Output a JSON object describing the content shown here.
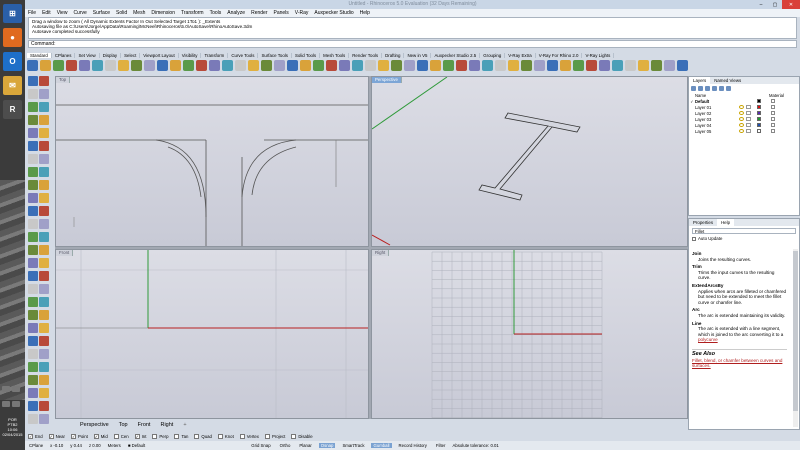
{
  "window": {
    "title": "Untitled - Rhinoceros 5.0 Evaluation (32 Days Remaining)"
  },
  "menu": [
    "File",
    "Edit",
    "View",
    "Curve",
    "Surface",
    "Solid",
    "Mesh",
    "Dimension",
    "Transform",
    "Tools",
    "Analyze",
    "Render",
    "Panels",
    "V-Ray",
    "Auxpecker Studio",
    "Help"
  ],
  "history": [
    "Drag a window to zoom ( All  Dynamic  Extents  Factor  In  Out  Selected  Target  1To1 ): _Extents",
    "Autosaving file as C:\\Users\\Jorge\\AppData\\Roaming\\McNeel\\Rhinoceros\\5.0\\AutoSave\\RhinoAutoSave.3dm",
    "Autosave completed successfully"
  ],
  "command": {
    "label": "Command:",
    "value": ""
  },
  "toolbar_tabs": [
    "Standard",
    "CPlanes",
    "Set View",
    "Display",
    "Select",
    "Viewport Layout",
    "Visibility",
    "Transform",
    "Curve Tools",
    "Surface Tools",
    "Solid Tools",
    "Mesh Tools",
    "Render Tools",
    "Drafting",
    "New in V5",
    "Auxpecker Studio 2.5",
    "Grouping",
    "V-Ray Extra",
    "V-Ray For Rhino 2.0",
    "V-Ray Lights"
  ],
  "viewports": {
    "top": "Top",
    "perspective": "Perspective",
    "front": "Front",
    "right": "Right"
  },
  "view_tabs": [
    "Perspective",
    "Top",
    "Front",
    "Right"
  ],
  "view_tabs_add": "+",
  "osnaps": [
    {
      "label": "End",
      "checked": true
    },
    {
      "label": "Near",
      "checked": true
    },
    {
      "label": "Point",
      "checked": true
    },
    {
      "label": "Mid",
      "checked": true
    },
    {
      "label": "Cen",
      "checked": false
    },
    {
      "label": "Int",
      "checked": true
    },
    {
      "label": "Perp",
      "checked": false
    },
    {
      "label": "Tan",
      "checked": false
    },
    {
      "label": "Quad",
      "checked": false
    },
    {
      "label": "Knot",
      "checked": false
    },
    {
      "label": "Vertex",
      "checked": false
    },
    {
      "label": "Project",
      "checked": false
    },
    {
      "label": "Disable",
      "checked": false
    }
  ],
  "status": {
    "cplane": "CPlane",
    "x": "x -0.10",
    "y": "y 0.44",
    "z": "z 0.00",
    "units": "Meters",
    "layer": "Default",
    "buttons": [
      {
        "label": "Grid Snap",
        "on": false
      },
      {
        "label": "Ortho",
        "on": false
      },
      {
        "label": "Planar",
        "on": false
      },
      {
        "label": "Osnap",
        "on": true
      },
      {
        "label": "SmartTrack",
        "on": false
      },
      {
        "label": "Gumball",
        "on": true
      },
      {
        "label": "Record History",
        "on": false
      },
      {
        "label": "Filter",
        "on": false
      }
    ],
    "tolerance": "Absolute tolerance: 0.01"
  },
  "layers_panel": {
    "tab_layers": "Layers",
    "tab_named_views": "Named Views",
    "col_name": "Name",
    "col_material": "Material",
    "layers": [
      {
        "name": "Default",
        "current": true,
        "color": "#000000"
      },
      {
        "name": "Layer 01",
        "current": false,
        "color": "#e01010"
      },
      {
        "name": "Layer 02",
        "current": false,
        "color": "#5a2ab0"
      },
      {
        "name": "Layer 03",
        "current": false,
        "color": "#1e9a2e"
      },
      {
        "name": "Layer 04",
        "current": false,
        "color": "#1e4fb0"
      },
      {
        "name": "Layer 05",
        "current": false,
        "color": "#ffffff"
      }
    ]
  },
  "help_panel": {
    "tab_properties": "Properties",
    "tab_help": "Help",
    "search_value": "Fillet",
    "auto_update": "Auto Update",
    "sections": [
      {
        "title": "Join",
        "text": "Joins the resulting curves."
      },
      {
        "title": "Trim",
        "text": "Trims the input curves to the resulting curve."
      },
      {
        "title": "ExtendArcsBy",
        "text": "Applies when arcs are filleted or chamfered but need to be extended to meet the fillet curve or chamfer line."
      },
      {
        "title": "Arc",
        "text": "The arc is extended maintaining its validity."
      },
      {
        "title": "Line",
        "text": "The arc is extended with a line segment, which is joined to the arc converting it to a"
      }
    ],
    "polycurve_link": "polycurve",
    "see_also": "See Also",
    "see_also_link": "Fillet, blend, or chamfer between curves and surfaces."
  },
  "taskbar": {
    "lang": "POR",
    "locale": "PTB2",
    "time": "10:06",
    "date": "02/04/2015"
  }
}
